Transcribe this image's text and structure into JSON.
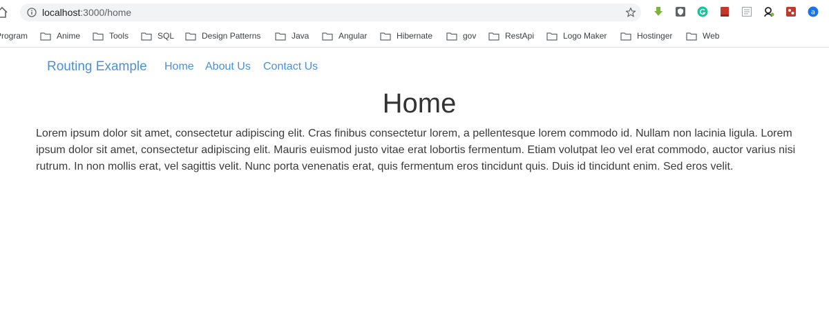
{
  "browser": {
    "url_host": "localhost",
    "url_path": ":3000/home",
    "extensions": [
      "download-extension-icon",
      "shield-extension-icon",
      "grammarly-icon",
      "red-book-icon",
      "reader-icon",
      "profile-extension-icon",
      "puzzle-extension-icon",
      "amazon-assistant-icon"
    ]
  },
  "bookmarks": [
    {
      "label": "Program"
    },
    {
      "label": "Anime"
    },
    {
      "label": "Tools"
    },
    {
      "label": "SQL"
    },
    {
      "label": "Design Patterns"
    },
    {
      "label": "Java"
    },
    {
      "label": "Angular"
    },
    {
      "label": "Hibernate"
    },
    {
      "label": "gov"
    },
    {
      "label": "RestApi"
    },
    {
      "label": "Logo Maker"
    },
    {
      "label": "Hostinger"
    },
    {
      "label": "Web"
    }
  ],
  "navbar": {
    "brand": "Routing Example",
    "links": [
      "Home",
      "About Us",
      "Contact Us"
    ]
  },
  "main": {
    "title": "Home",
    "body": "Lorem ipsum dolor sit amet, consectetur adipiscing elit. Cras finibus consectetur lorem, a pellentesque lorem commodo id. Nullam non lacinia ligula. Lorem ipsum dolor sit amet, consectetur adipiscing elit. Mauris euismod justo vitae erat lobortis fermentum. Etiam volutpat leo vel erat commodo, auctor varius nisi rutrum. In non mollis erat, vel sagittis velit. Nunc porta venenatis erat, quis fermentum eros tincidunt quis. Duis id tincidunt enim. Sed eros velit."
  },
  "colors": {
    "link": "#4a90d9",
    "heading": "#333333"
  }
}
